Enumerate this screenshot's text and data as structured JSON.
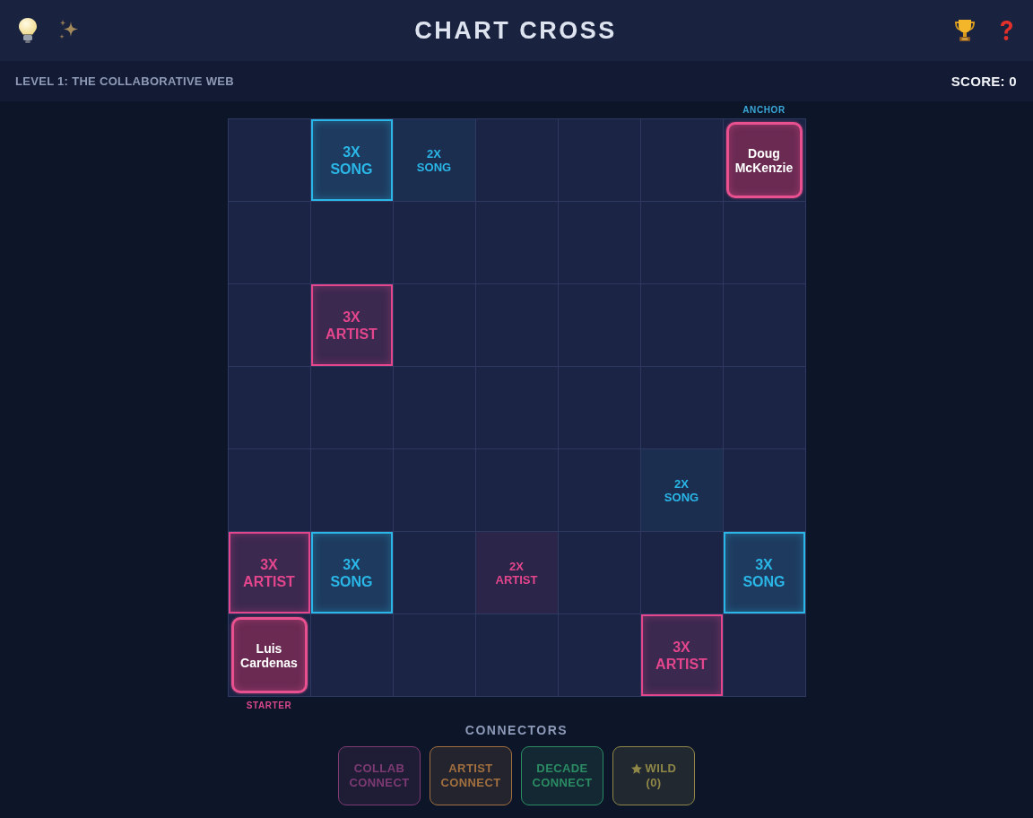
{
  "header": {
    "title": "CHART CROSS"
  },
  "level_bar": {
    "level_title": "LEVEL 1: THE COLLABORATIVE WEB",
    "score": "SCORE: 0"
  },
  "board": {
    "rows": [
      {
        "cells": [
          {
            "kind": "empty"
          },
          {
            "kind": "bonus",
            "outlined": true,
            "color": "#2ab6e6",
            "multiplier": "3X",
            "label": "SONG"
          },
          {
            "kind": "bonus",
            "outlined": false,
            "color": "#2ab6e6",
            "multiplier": "2X",
            "label": "SONG"
          },
          {
            "kind": "empty"
          },
          {
            "kind": "empty"
          },
          {
            "kind": "empty"
          },
          {
            "kind": "player",
            "name": "Doug McKenzie",
            "tag": {
              "text": "ANCHOR",
              "above": true,
              "color": "#3aa8d8"
            }
          }
        ]
      },
      {
        "cells": [
          {
            "kind": "empty"
          },
          {
            "kind": "empty"
          },
          {
            "kind": "empty"
          },
          {
            "kind": "empty"
          },
          {
            "kind": "empty"
          },
          {
            "kind": "empty"
          },
          {
            "kind": "empty"
          }
        ]
      },
      {
        "cells": [
          {
            "kind": "empty"
          },
          {
            "kind": "bonus",
            "outlined": true,
            "color": "#e3468c",
            "multiplier": "3X",
            "label": "ARTIST"
          },
          {
            "kind": "empty"
          },
          {
            "kind": "empty"
          },
          {
            "kind": "empty"
          },
          {
            "kind": "empty"
          },
          {
            "kind": "empty"
          }
        ]
      },
      {
        "cells": [
          {
            "kind": "empty"
          },
          {
            "kind": "empty"
          },
          {
            "kind": "empty"
          },
          {
            "kind": "empty"
          },
          {
            "kind": "empty"
          },
          {
            "kind": "empty"
          },
          {
            "kind": "empty"
          }
        ]
      },
      {
        "cells": [
          {
            "kind": "empty"
          },
          {
            "kind": "empty"
          },
          {
            "kind": "empty"
          },
          {
            "kind": "empty"
          },
          {
            "kind": "empty"
          },
          {
            "kind": "bonus",
            "outlined": false,
            "color": "#2ab6e6",
            "multiplier": "2X",
            "label": "SONG"
          },
          {
            "kind": "empty"
          }
        ]
      },
      {
        "cells": [
          {
            "kind": "bonus",
            "outlined": true,
            "color": "#e3468c",
            "multiplier": "3X",
            "label": "ARTIST"
          },
          {
            "kind": "bonus",
            "outlined": true,
            "color": "#2ab6e6",
            "multiplier": "3X",
            "label": "SONG"
          },
          {
            "kind": "empty"
          },
          {
            "kind": "bonus",
            "outlined": false,
            "color": "#e3468c",
            "multiplier": "2X",
            "label": "ARTIST"
          },
          {
            "kind": "empty"
          },
          {
            "kind": "empty"
          },
          {
            "kind": "bonus",
            "outlined": true,
            "color": "#2ab6e6",
            "multiplier": "3X",
            "label": "SONG"
          }
        ]
      },
      {
        "cells": [
          {
            "kind": "player",
            "name": "Luis Cardenas",
            "tag": {
              "text": "STARTER",
              "above": false,
              "color": "#d6488a"
            }
          },
          {
            "kind": "empty"
          },
          {
            "kind": "empty"
          },
          {
            "kind": "empty"
          },
          {
            "kind": "empty"
          },
          {
            "kind": "bonus",
            "outlined": true,
            "color": "#e3468c",
            "multiplier": "3X",
            "label": "ARTIST"
          },
          {
            "kind": "empty"
          }
        ]
      }
    ]
  },
  "connectors": {
    "title": "CONNECTORS",
    "buttons": [
      {
        "kind": "connect",
        "label": "COLLAB CONNECT",
        "color": "#7e3a72"
      },
      {
        "kind": "connect",
        "label": "ARTIST CONNECT",
        "color": "#a2703e"
      },
      {
        "kind": "connect",
        "label": "DECADE CONNECT",
        "color": "#2b8c63"
      },
      {
        "kind": "wild",
        "label": "WILD",
        "count": "(0)",
        "color": "#8f8748"
      }
    ]
  }
}
